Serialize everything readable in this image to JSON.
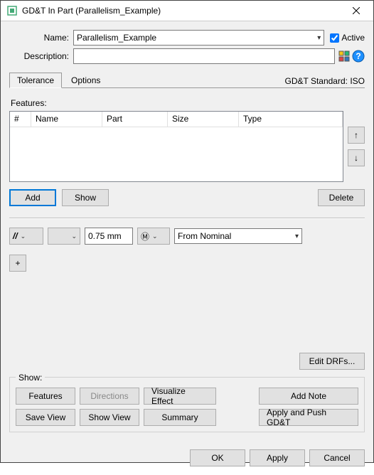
{
  "titlebar": {
    "title": "GD&T In Part (Parallelism_Example)"
  },
  "form": {
    "name_label": "Name:",
    "name_value": "Parallelism_Example",
    "active_label": "Active",
    "active_checked": true,
    "desc_label": "Description:",
    "desc_value": ""
  },
  "tabs": {
    "tolerance": "Tolerance",
    "options": "Options",
    "standard": "GD&T Standard: ISO"
  },
  "features": {
    "title": "Features:",
    "cols": {
      "num": "#",
      "name": "Name",
      "part": "Part",
      "size": "Size",
      "type": "Type"
    },
    "add": "Add",
    "show": "Show",
    "delete": "Delete"
  },
  "tolerance": {
    "symbol": "//",
    "value": "0.75 mm",
    "modifier": "Ⓜ",
    "reference": "From Nominal",
    "plus": "+",
    "edit_drfs": "Edit DRFs..."
  },
  "show": {
    "title": "Show:",
    "features": "Features",
    "directions": "Directions",
    "visualize": "Visualize Effect",
    "addnote": "Add Note",
    "saveview": "Save View",
    "showview": "Show View",
    "summary": "Summary",
    "applypush": "Apply and Push GD&T"
  },
  "dialog": {
    "ok": "OK",
    "apply": "Apply",
    "cancel": "Cancel"
  }
}
